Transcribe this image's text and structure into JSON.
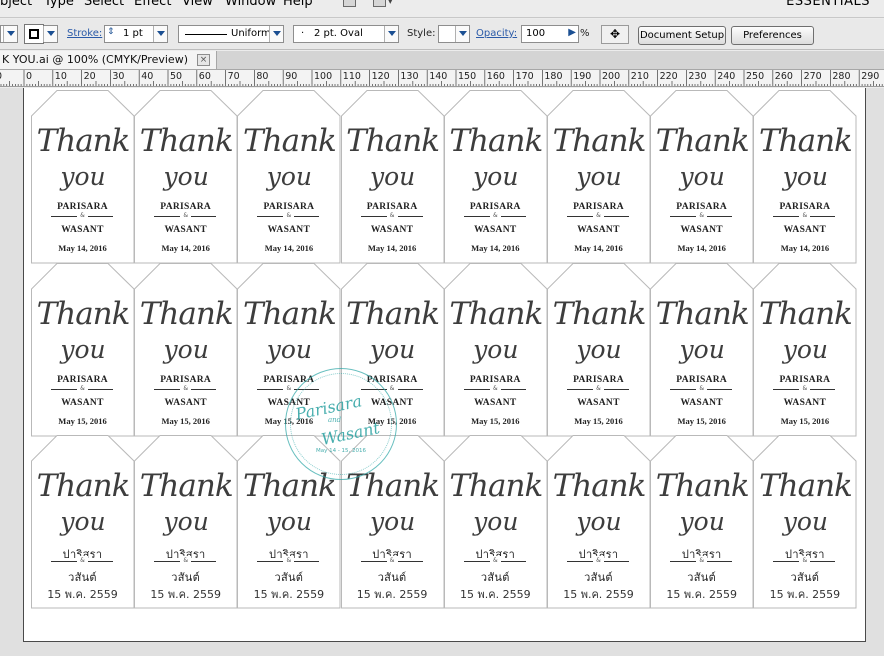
{
  "menubar": {
    "items": [
      "bject",
      "Type",
      "Select",
      "Effect",
      "View",
      "Window",
      "Help"
    ],
    "workspace": "ESSENTIALS"
  },
  "controls": {
    "stroke_label": "Stroke:",
    "stroke_value": "1 pt",
    "profile_value": "Uniform",
    "brush_value": "2 pt. Oval",
    "style_label": "Style:",
    "opacity_label": "Opacity:",
    "opacity_value": "100",
    "percent": "%",
    "document_setup": "Document Setup",
    "preferences": "Preferences"
  },
  "document": {
    "tab_title": "K YOU.ai @ 100% (CMYK/Preview)",
    "close_glyph": "×"
  },
  "ruler": {
    "labels": [
      "0",
      "0",
      "10",
      "20",
      "30",
      "40",
      "50",
      "60",
      "70",
      "80",
      "90",
      "100",
      "110",
      "120",
      "130",
      "140",
      "150",
      "160",
      "170",
      "180",
      "190",
      "200",
      "210",
      "220",
      "230",
      "240",
      "250",
      "260",
      "270",
      "280",
      "290",
      "30"
    ]
  },
  "tag_rows": [
    {
      "line1": "Thank",
      "line2": "you",
      "name1": "PARISARA",
      "amp": "&",
      "name2": "WASANT",
      "date": "May 14, 2016",
      "script": "latin"
    },
    {
      "line1": "Thank",
      "line2": "you",
      "name1": "PARISARA",
      "amp": "&",
      "name2": "WASANT",
      "date": "May 15, 2016",
      "script": "latin"
    },
    {
      "line1": "Thank",
      "line2": "you",
      "name1": "ปาริสรา",
      "amp": "&",
      "name2": "วสันต์",
      "date": "15 พ.ค. 2559",
      "script": "thai"
    }
  ],
  "tag_columns": 8,
  "stamp": {
    "name1": "Parisara",
    "amp": "and",
    "name2": "Wasant",
    "date": "May 14 - 15, 2016"
  },
  "colors": {
    "stamp_teal": "#36aaaa",
    "accent_link": "#2a5aa8"
  }
}
